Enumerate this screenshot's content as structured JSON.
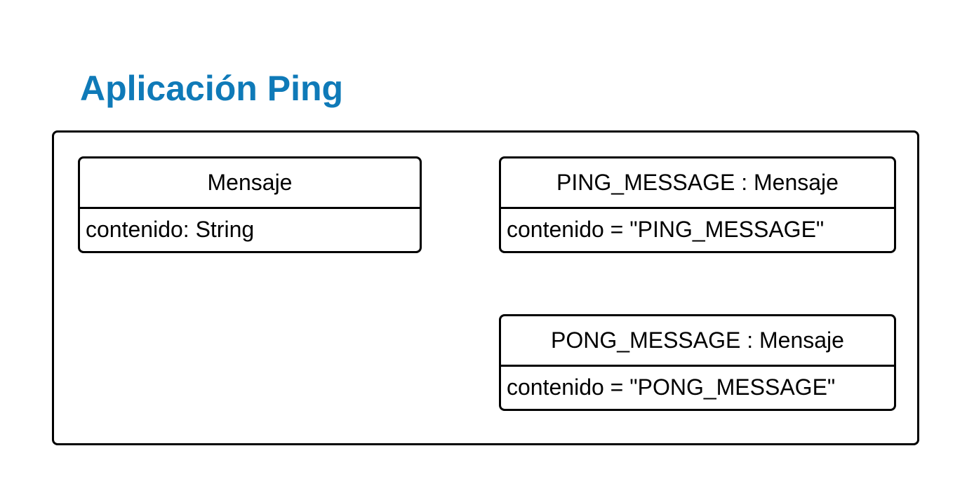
{
  "title": "Aplicación Ping",
  "classes": [
    {
      "header": "Mensaje",
      "attribute": "contenido: String"
    },
    {
      "header": "PING_MESSAGE : Mensaje",
      "attribute": "contenido = \"PING_MESSAGE\""
    },
    {
      "header": "PONG_MESSAGE : Mensaje",
      "attribute": "contenido = \"PONG_MESSAGE\""
    }
  ]
}
